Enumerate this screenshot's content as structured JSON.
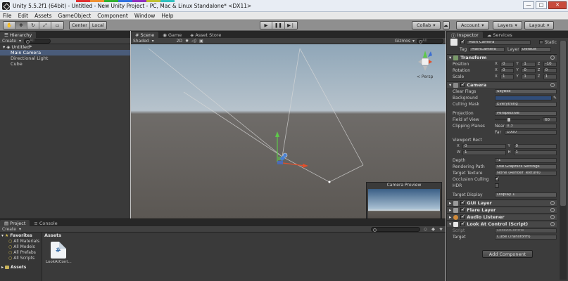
{
  "window": {
    "title": "Unity 5.5.2f1 (64bit) - Untitled - New Unity Project - PC, Mac & Linux Standalone* <DX11>",
    "minimize": "—",
    "maximize": "□",
    "close": "✕"
  },
  "menu": [
    "File",
    "Edit",
    "Assets",
    "GameObject",
    "Component",
    "Window",
    "Help"
  ],
  "toolbar": {
    "pivot": "Center",
    "space": "Local",
    "collab": "Collab",
    "account": "Account",
    "layers": "Layers",
    "layout": "Layout"
  },
  "hierarchy": {
    "tab": "Hierarchy",
    "create": "Create",
    "search_placeholder": "All",
    "scene": "Untitled*",
    "items": [
      "Main Camera",
      "Directional Light",
      "Cube"
    ]
  },
  "scene_view": {
    "tabs": [
      "Scene",
      "Game",
      "Asset Store"
    ],
    "shading": "Shaded",
    "mode_2d": "2D",
    "gizmos": "Gizmos",
    "search_placeholder": "All",
    "persp_label": "< Persp",
    "camera_preview": "Camera Preview"
  },
  "inspector": {
    "tabs": [
      "Inspector",
      "Services"
    ],
    "object_name": "Main Camera",
    "static_label": "Static",
    "tag_label": "Tag",
    "tag": "MainCamera",
    "layer_label": "Layer",
    "layer": "Default",
    "transform": {
      "header": "Transform",
      "rows": [
        {
          "label": "Position",
          "x": "0",
          "y": "1",
          "z": "-10"
        },
        {
          "label": "Rotation",
          "x": "0",
          "y": "0",
          "z": "0"
        },
        {
          "label": "Scale",
          "x": "1",
          "y": "1",
          "z": "1"
        }
      ]
    },
    "camera": {
      "header": "Camera",
      "clear_flags_label": "Clear Flags",
      "clear_flags": "Skybox",
      "background_label": "Background",
      "culling_mask_label": "Culling Mask",
      "culling_mask": "Everything",
      "projection_label": "Projection",
      "projection": "Perspective",
      "fov_label": "Field of View",
      "fov": "60",
      "clipping_label": "Clipping Planes",
      "near_label": "Near",
      "near": "0.3",
      "far_label": "Far",
      "far": "1000",
      "viewport_label": "Viewport Rect",
      "vx": "0",
      "vy": "0",
      "vw": "1",
      "vh": "1",
      "depth_label": "Depth",
      "depth": "-1",
      "rendering_path_label": "Rendering Path",
      "rendering_path": "Use Graphics Settings",
      "target_texture_label": "Target Texture",
      "target_texture": "None (Render Texture)",
      "occlusion_label": "Occlusion Culling",
      "hdr_label": "HDR",
      "target_display_label": "Target Display",
      "target_display": "Display 1"
    },
    "components": [
      "GUI Layer",
      "Flare Layer",
      "Audio Listener",
      "Look At Control (Script)"
    ],
    "script_label": "Script",
    "script_value": "LookAtControl",
    "target_label": "Target",
    "target_value": "Cube (Transform)",
    "add_component": "Add Component"
  },
  "project": {
    "tabs": [
      "Project",
      "Console"
    ],
    "create": "Create",
    "favorites_label": "Favorites",
    "favorites": [
      "All Materials",
      "All Models",
      "All Prefabs",
      "All Scripts"
    ],
    "assets_label": "Assets",
    "asset_name": "LookAtCont..."
  },
  "colors": {
    "camera_background": "#314d79",
    "selection": "#4a5c7a"
  }
}
